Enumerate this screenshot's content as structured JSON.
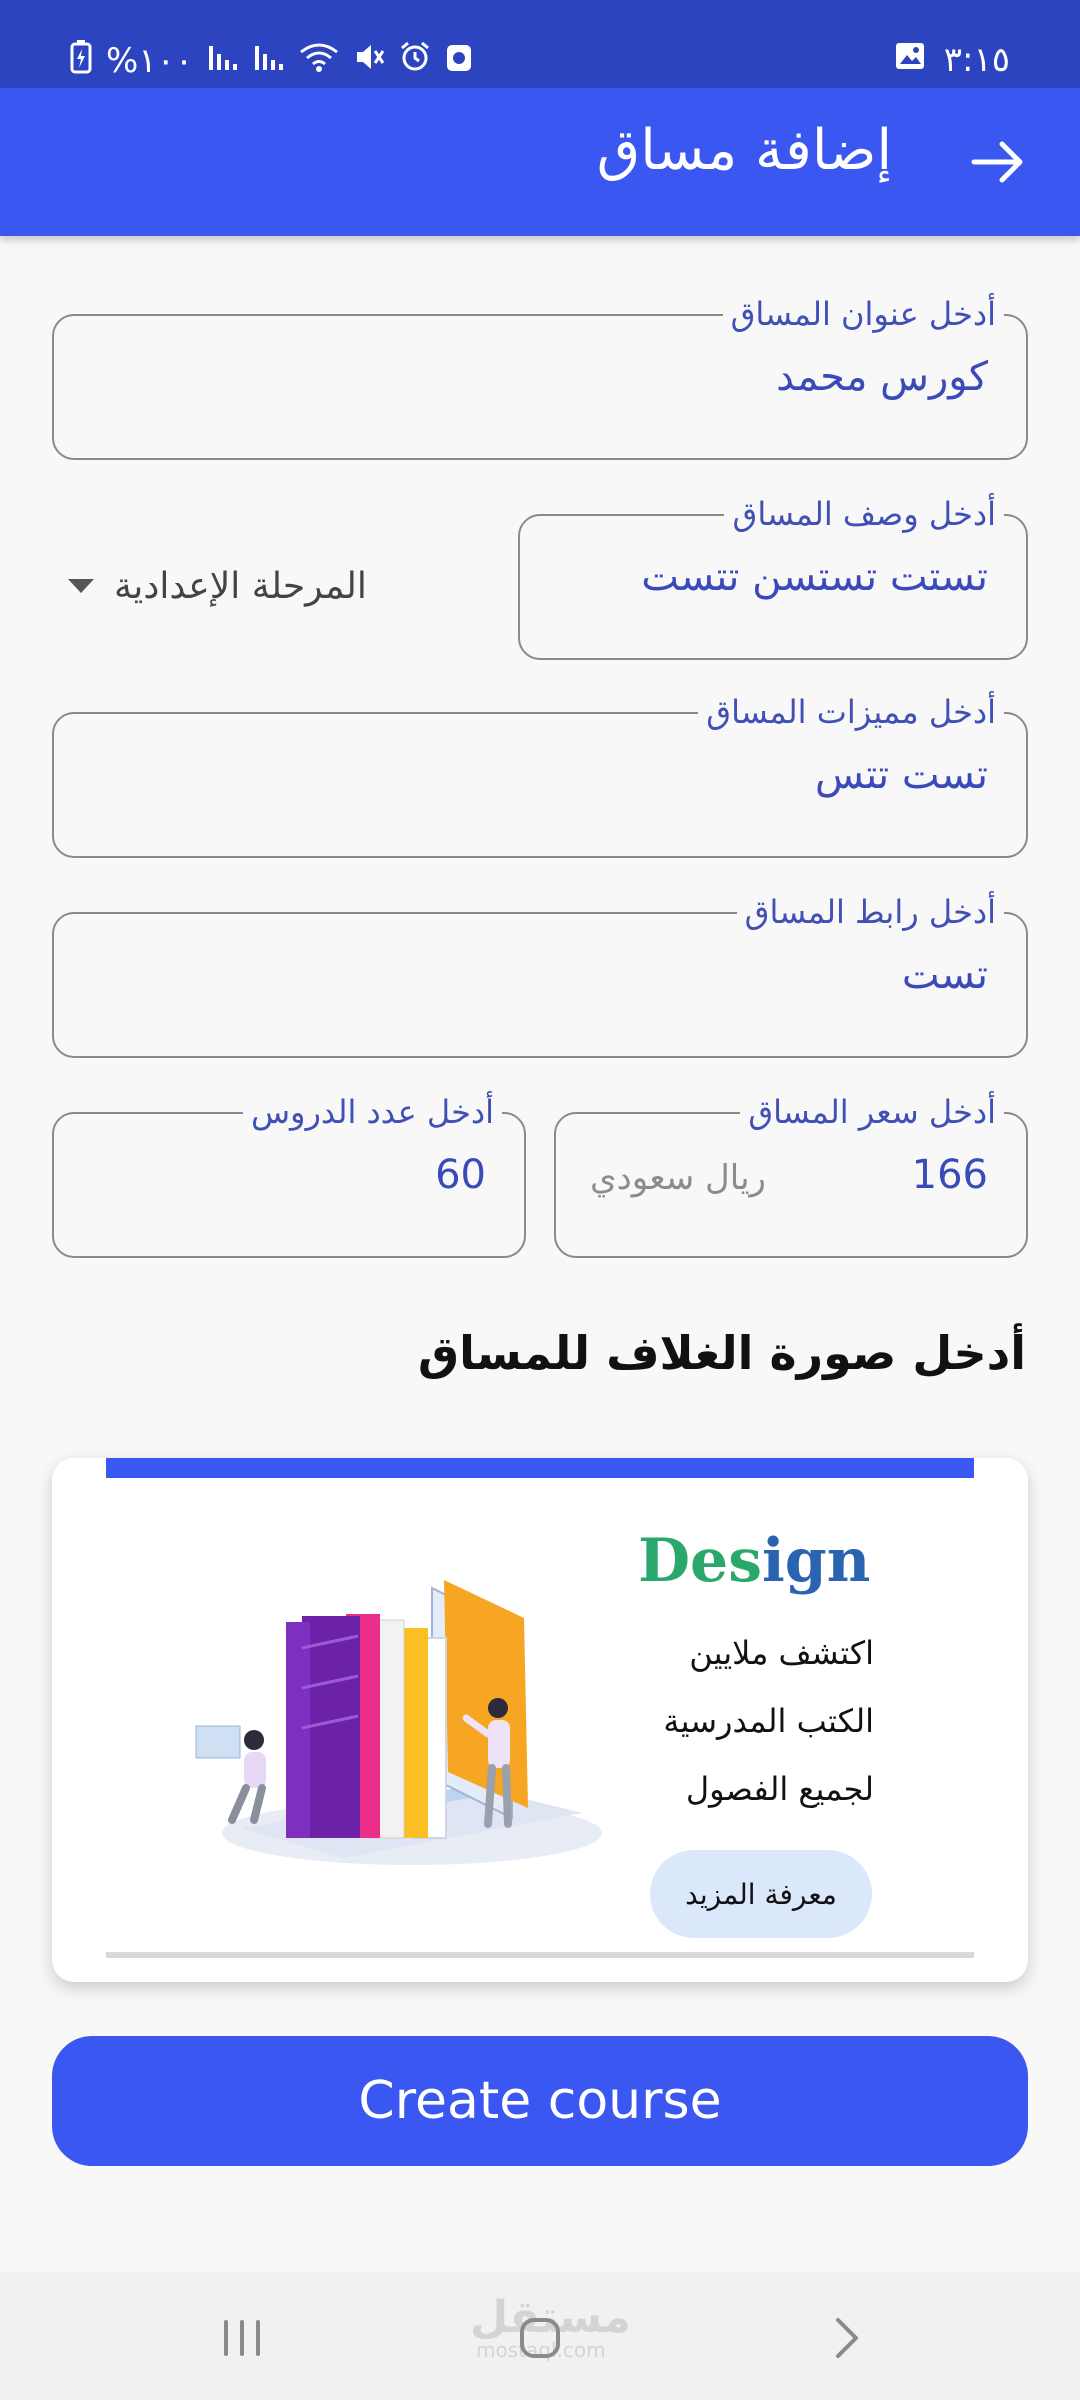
{
  "status_bar": {
    "left_text": "%١٠٠",
    "time": "٣:١٥"
  },
  "app_bar": {
    "title": "إضافة مساق",
    "back_icon": "arrow-right-icon"
  },
  "form": {
    "title_field": {
      "label": "أدخل عنوان المساق",
      "value": "كورس محمد"
    },
    "description_field": {
      "label": "أدخل وصف المساق",
      "value": "تستت تستسن تتست"
    },
    "stage_select": {
      "value": "المرحلة الإعدادية"
    },
    "features_field": {
      "label": "أدخل مميزات المساق",
      "value": "تست تتس"
    },
    "link_field": {
      "label": "أدخل رابط المساق",
      "value": "تست"
    },
    "price_field": {
      "label": "أدخل سعر المساق",
      "value": "166",
      "suffix": "ريال سعودي"
    },
    "lessons_field": {
      "label": "أدخل عدد الدروس",
      "value": "60"
    }
  },
  "cover": {
    "heading": "أدخل صورة الغلاف للمساق",
    "card": {
      "design_part1": "Des",
      "design_part2": "ign",
      "line1": "اكتشف ملايين",
      "line2": "الكتب المدرسية",
      "line3": "لجميع الفصول",
      "button": "معرفة المزيد"
    }
  },
  "create_button": "Create course",
  "nav": {
    "watermark": "مستقل",
    "watermark_sub": "mostaql.com"
  },
  "colors": {
    "primary": "#3a57f2",
    "status_bar": "#2c44c0",
    "label": "#4050b5"
  }
}
